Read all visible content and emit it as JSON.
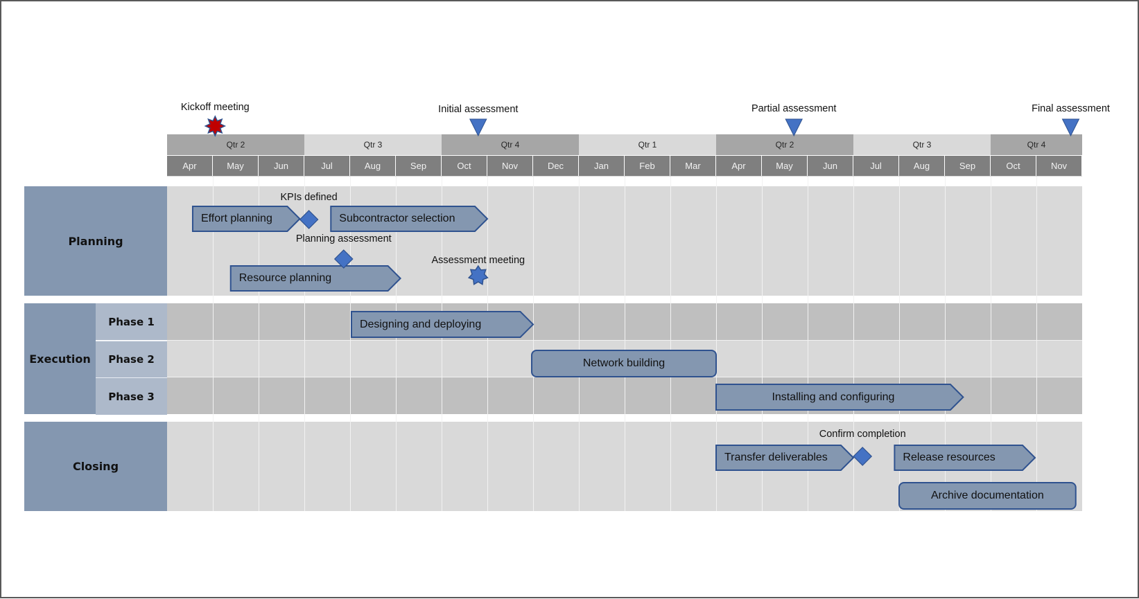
{
  "timeline": {
    "start_month": "Apr",
    "month_count": 20,
    "quarters": [
      {
        "label": "Qtr 2",
        "start": 0,
        "months": 3,
        "shade": "dark"
      },
      {
        "label": "Qtr 3",
        "start": 3,
        "months": 3,
        "shade": "light"
      },
      {
        "label": "Qtr 4",
        "start": 6,
        "months": 3,
        "shade": "dark"
      },
      {
        "label": "Qtr 1",
        "start": 9,
        "months": 3,
        "shade": "light"
      },
      {
        "label": "Qtr 2",
        "start": 12,
        "months": 3,
        "shade": "dark"
      },
      {
        "label": "Qtr 3",
        "start": 15,
        "months": 3,
        "shade": "light"
      },
      {
        "label": "Qtr 4",
        "start": 18,
        "months": 2,
        "shade": "dark"
      }
    ],
    "months": [
      "Apr",
      "May",
      "Jun",
      "Jul",
      "Aug",
      "Sep",
      "Oct",
      "Nov",
      "Dec",
      "Jan",
      "Feb",
      "Mar",
      "Apr",
      "May",
      "Jun",
      "Jul",
      "Aug",
      "Sep",
      "Oct",
      "Nov"
    ]
  },
  "top_milestones": [
    {
      "label": "Kickoff meeting",
      "at": 1.05,
      "icon": "star-icon",
      "color": "#c00000"
    },
    {
      "label": "Initial assessment",
      "at": 6.8,
      "icon": "triangle-down-icon",
      "color": "#4472c4"
    },
    {
      "label": "Partial assessment",
      "at": 13.7,
      "icon": "triangle-down-icon",
      "color": "#4472c4"
    },
    {
      "label": "Final assessment",
      "at": 19.75,
      "icon": "triangle-down-icon",
      "color": "#4472c4"
    }
  ],
  "swimlanes": {
    "planning": {
      "label": "Planning"
    },
    "execution": {
      "label": "Execution",
      "phases": [
        "Phase 1",
        "Phase 2",
        "Phase 3"
      ]
    },
    "closing": {
      "label": "Closing"
    }
  },
  "tasks": [
    {
      "label": "Effort planning",
      "lane": "planning",
      "row": 0,
      "start": 0.56,
      "end": 2.9,
      "shape": "chevron",
      "align": "left"
    },
    {
      "label": "Subcontractor selection",
      "lane": "planning",
      "row": 0,
      "start": 3.58,
      "end": 7.0,
      "shape": "chevron",
      "align": "left"
    },
    {
      "label": "Resource planning",
      "lane": "planning",
      "row": 1,
      "start": 1.39,
      "end": 5.1,
      "shape": "chevron",
      "align": "left"
    },
    {
      "label": "Designing and deploying",
      "lane": "phase1",
      "row": 0,
      "start": 4.03,
      "end": 8.0,
      "shape": "chevron",
      "align": "left"
    },
    {
      "label": "Network building",
      "lane": "phase2",
      "row": 0,
      "start": 7.97,
      "end": 12.0,
      "shape": "rounded",
      "align": "center"
    },
    {
      "label": "Installing and configuring",
      "lane": "phase3",
      "row": 0,
      "start": 12.0,
      "end": 17.4,
      "shape": "chevron",
      "align": "center"
    },
    {
      "label": "Transfer deliverables",
      "lane": "closing",
      "row": 0,
      "start": 12.0,
      "end": 15.0,
      "shape": "chevron",
      "align": "left"
    },
    {
      "label": "Release resources",
      "lane": "closing",
      "row": 0,
      "start": 15.9,
      "end": 18.97,
      "shape": "chevron",
      "align": "left"
    },
    {
      "label": "Archive documentation",
      "lane": "closing",
      "row": 1,
      "start": 16.0,
      "end": 19.86,
      "shape": "rounded",
      "align": "center"
    }
  ],
  "milestones": [
    {
      "label": "KPIs defined",
      "lane": "planning",
      "slot": "kpi",
      "at": 3.1,
      "icon": "diamond-icon"
    },
    {
      "label": "Planning assessment",
      "lane": "planning",
      "slot": "pa",
      "at": 3.86,
      "icon": "diamond-icon"
    },
    {
      "label": "Assessment meeting",
      "lane": "planning",
      "slot": "am",
      "at": 6.8,
      "icon": "star-icon"
    },
    {
      "label": "Confirm completion",
      "lane": "closing",
      "slot": "cc",
      "at": 15.2,
      "icon": "diamond-icon"
    }
  ],
  "colors": {
    "quarter_dark": "#a6a6a6",
    "quarter_light": "#d9d9d9",
    "month_bg": "#7f7f7f",
    "lane_light": "#d9d9d9",
    "lane_dark": "#bfbfbf",
    "lane_label": "#8497b0",
    "phase_label": "#adb9ca",
    "task_fill": "#8497b0",
    "task_stroke": "#2f528f",
    "milestone": "#4472c4"
  }
}
